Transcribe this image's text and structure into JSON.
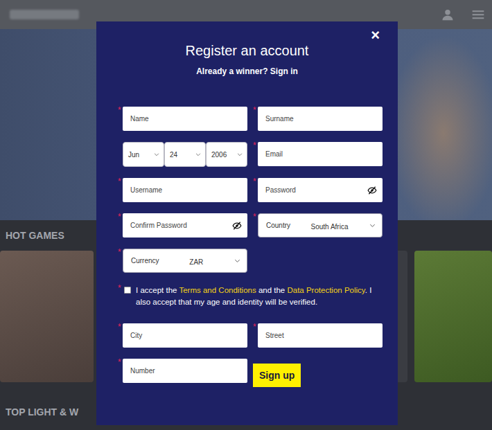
{
  "background": {
    "sections": [
      {
        "title": "HOT GAMES"
      },
      {
        "title": "TOP LIGHT & W"
      }
    ]
  },
  "modal": {
    "title": "Register an account",
    "signin_prompt": "Already a winner? Sign in",
    "close": "×"
  },
  "required_mark": "*",
  "fields_top": [
    {
      "kind": "text",
      "placeholder": "Name",
      "required": true
    },
    {
      "kind": "text",
      "placeholder": "Surname",
      "required": true
    },
    {
      "kind": "date",
      "parts": [
        "Jun",
        "24",
        "2006"
      ],
      "required": false
    },
    {
      "kind": "text",
      "placeholder": "Email",
      "required": true
    },
    {
      "kind": "text",
      "placeholder": "Username",
      "required": true
    },
    {
      "kind": "password",
      "placeholder": "Password",
      "required": true
    },
    {
      "kind": "password",
      "placeholder": "Confirm Password",
      "required": true
    },
    {
      "kind": "select",
      "label": "Country",
      "value": "South Africa",
      "required": true
    },
    {
      "kind": "select",
      "label": "Currency",
      "value": "ZAR",
      "required": true
    }
  ],
  "terms": {
    "checked": false,
    "required": true,
    "parts": [
      {
        "text": "I accept the ",
        "link": false
      },
      {
        "text": "Terms and Conditions",
        "link": true
      },
      {
        "text": " and the ",
        "link": false
      },
      {
        "text": "Data Protection Policy",
        "link": true
      },
      {
        "text": ". I also accept that my age and identity will be verified.",
        "link": false
      }
    ]
  },
  "fields_bottom": [
    {
      "kind": "text",
      "placeholder": "City",
      "required": true
    },
    {
      "kind": "text",
      "placeholder": "Street",
      "required": true
    },
    {
      "kind": "text",
      "placeholder": "Number",
      "required": true
    }
  ],
  "submit": "Sign up"
}
